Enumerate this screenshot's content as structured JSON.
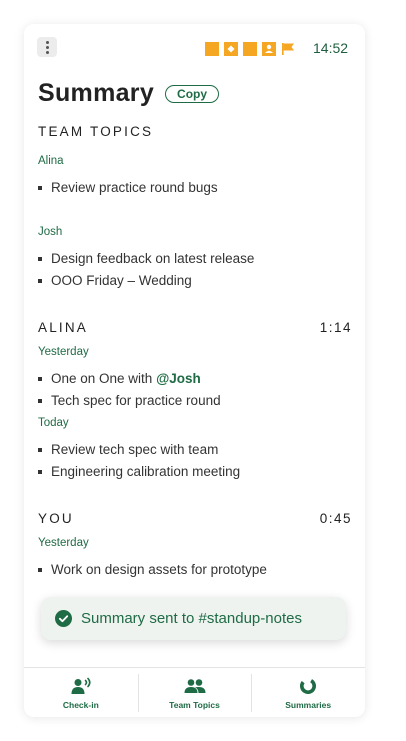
{
  "status_bar": {
    "time": "14:52",
    "icons": [
      "square-icon",
      "diamond-icon",
      "square-icon",
      "person-icon",
      "flag-icon"
    ],
    "icon_color": "#f5a623"
  },
  "header": {
    "title": "Summary",
    "copy_label": "Copy"
  },
  "team_topics": {
    "heading": "TEAM TOPICS",
    "groups": [
      {
        "name": "Alina",
        "items": [
          "Review practice round bugs"
        ]
      },
      {
        "name": "Josh",
        "items": [
          "Design feedback on latest release",
          "OOO Friday – Wedding"
        ]
      }
    ]
  },
  "alina": {
    "heading": "ALINA",
    "time": "1:14",
    "yesterday_label": "Yesterday",
    "yesterday_items": [
      {
        "prefix": "One on One with ",
        "mention": "@Josh"
      },
      {
        "text": "Tech spec for practice round"
      }
    ],
    "today_label": "Today",
    "today_items": [
      "Review tech spec with team",
      "Engineering calibration meeting"
    ]
  },
  "you": {
    "heading": "YOU",
    "time": "0:45",
    "yesterday_label": "Yesterday",
    "yesterday_items": [
      "Work on design assets for prototype"
    ]
  },
  "toast": {
    "message": "Summary sent to #standup-notes"
  },
  "nav": {
    "items": [
      {
        "label": "Check-in",
        "icon": "person-speaking-icon"
      },
      {
        "label": "Team Topics",
        "icon": "group-icon"
      },
      {
        "label": "Summaries",
        "icon": "donut-chart-icon"
      }
    ]
  },
  "colors": {
    "accent": "#1f6b45",
    "status_icons": "#f5a623",
    "toast_bg": "#eef3ef"
  }
}
